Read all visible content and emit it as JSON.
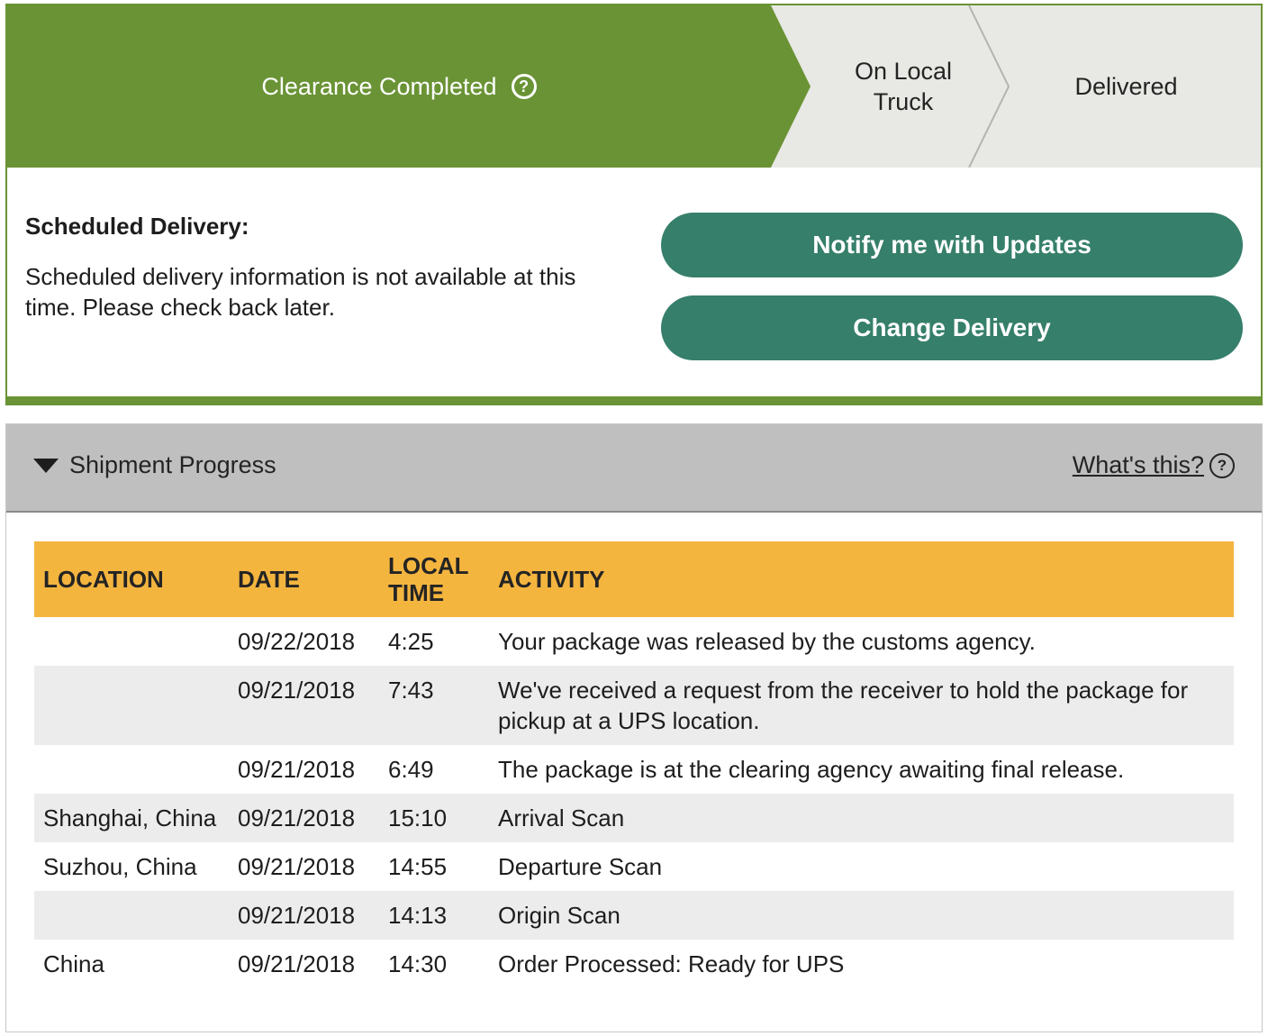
{
  "progress": {
    "current_step": "Clearance Completed",
    "current_help_glyph": "?",
    "steps": [
      "On Local\nTruck",
      "Delivered"
    ],
    "colors": {
      "active": "#6a9335",
      "inactive": "#e8e8e4",
      "divider": "#b5b5b0"
    }
  },
  "scheduled": {
    "title": "Scheduled Delivery:",
    "text": "Scheduled delivery information is not available at this time. Please check back later."
  },
  "buttons": {
    "notify": "Notify me with Updates",
    "change": "Change Delivery"
  },
  "panel": {
    "title": "Shipment Progress",
    "whats_this": "What's this?",
    "help_glyph": "?"
  },
  "table": {
    "headers": {
      "location": "LOCATION",
      "date": "DATE",
      "time": "LOCAL TIME",
      "activity": "ACTIVITY"
    },
    "rows": [
      {
        "location": "",
        "date": "09/22/2018",
        "time": "4:25",
        "activity": "Your package was released by the customs agency."
      },
      {
        "location": "",
        "date": "09/21/2018",
        "time": "7:43",
        "activity": "We've received a request from the receiver to hold the package for pickup at a UPS location."
      },
      {
        "location": "",
        "date": "09/21/2018",
        "time": "6:49",
        "activity": "The package is at the clearing agency awaiting final release."
      },
      {
        "location": "Shanghai, China",
        "date": "09/21/2018",
        "time": "15:10",
        "activity": "Arrival Scan"
      },
      {
        "location": "Suzhou, China",
        "date": "09/21/2018",
        "time": "14:55",
        "activity": "Departure Scan"
      },
      {
        "location": "",
        "date": "09/21/2018",
        "time": "14:13",
        "activity": "Origin Scan"
      },
      {
        "location": "China",
        "date": "09/21/2018",
        "time": "14:30",
        "activity": "Order Processed: Ready for UPS"
      }
    ]
  }
}
